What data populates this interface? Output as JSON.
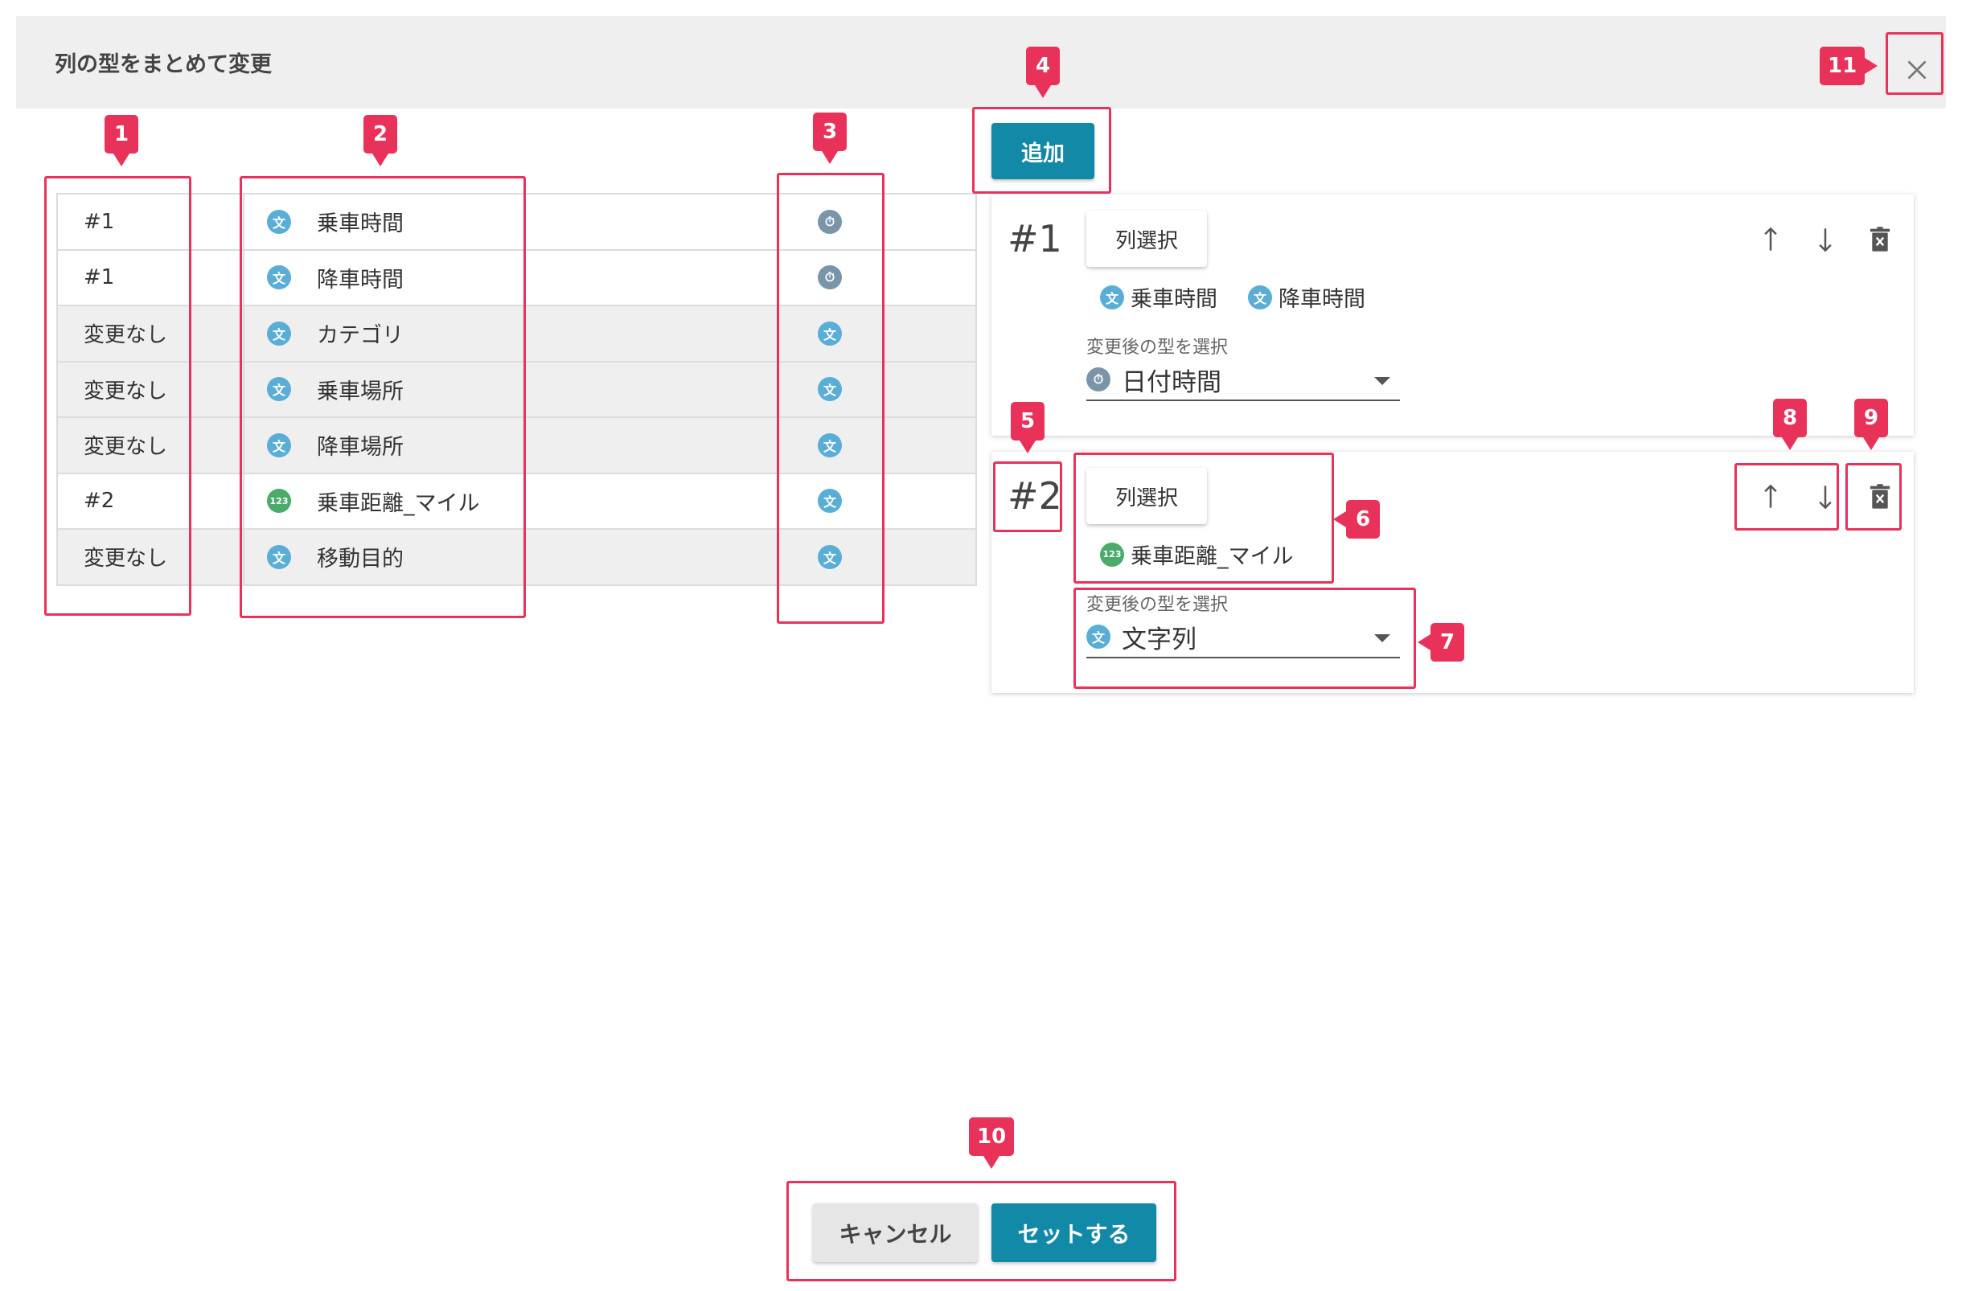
{
  "dialog": {
    "title": "列の型をまとめて変更",
    "close_icon": "close-icon"
  },
  "columns": [
    {
      "group": "#1",
      "type": "text",
      "type_glyph": "文",
      "name": "乗車時間",
      "new_type": "date",
      "new_glyph": "⏱"
    },
    {
      "group": "#1",
      "type": "text",
      "type_glyph": "文",
      "name": "降車時間",
      "new_type": "date",
      "new_glyph": "⏱"
    },
    {
      "group": "変更なし",
      "type": "text",
      "type_glyph": "文",
      "name": "カテゴリ",
      "new_type": "text",
      "new_glyph": "文"
    },
    {
      "group": "変更なし",
      "type": "text",
      "type_glyph": "文",
      "name": "乗車場所",
      "new_type": "text",
      "new_glyph": "文"
    },
    {
      "group": "変更なし",
      "type": "text",
      "type_glyph": "文",
      "name": "降車場所",
      "new_type": "text",
      "new_glyph": "文"
    },
    {
      "group": "#2",
      "type": "num",
      "type_glyph": "123",
      "name": "乗車距離_マイル",
      "new_type": "text",
      "new_glyph": "文"
    },
    {
      "group": "変更なし",
      "type": "text",
      "type_glyph": "文",
      "name": "移動目的",
      "new_type": "text",
      "new_glyph": "文"
    }
  ],
  "add_button": "追加",
  "groups": [
    {
      "number": "#1",
      "select_label": "列選択",
      "chips": [
        {
          "glyph": "文",
          "name": "乗車時間"
        },
        {
          "glyph": "文",
          "name": "降車時間"
        }
      ],
      "type_label": "変更後の型を選択",
      "type_glyph": "⏱",
      "type_value": "日付時間"
    },
    {
      "number": "#2",
      "select_label": "列選択",
      "chips": [
        {
          "glyph": "123",
          "name": "乗車距離_マイル"
        }
      ],
      "type_label": "変更後の型を選択",
      "type_glyph": "文",
      "type_value": "文字列"
    }
  ],
  "footer": {
    "cancel": "キャンセル",
    "submit": "セットする"
  },
  "annotations": [
    "1",
    "2",
    "3",
    "4",
    "5",
    "6",
    "7",
    "8",
    "9",
    "10",
    "11"
  ],
  "colors": {
    "accent": "#1289a7",
    "annotation": "#e8325a",
    "text_type": "#5aaed6",
    "num_type": "#4aab6a",
    "date_type": "#7b95a8"
  }
}
